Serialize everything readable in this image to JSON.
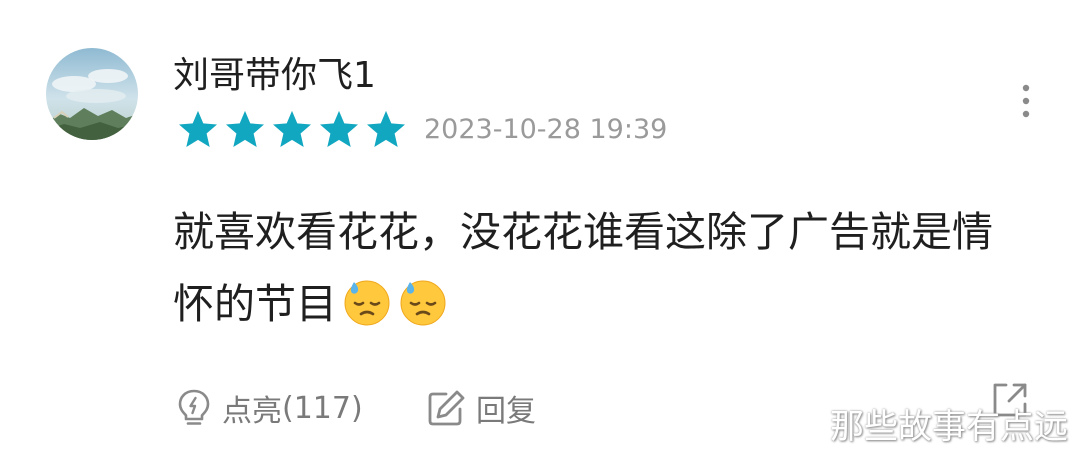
{
  "user": {
    "name": "刘哥带你飞1",
    "avatar_icon": "landscape-avatar"
  },
  "rating": {
    "stars": 5,
    "max_stars": 5,
    "star_color": "#12a7c0"
  },
  "timestamp": "2023-10-28 19:39",
  "comment": {
    "text": "就喜欢看花花，没花花谁看这除了广告就是情怀的节目",
    "emojis": [
      "downcast-sweat-emoji",
      "downcast-sweat-emoji"
    ]
  },
  "actions": {
    "like_icon": "lightbulb-icon",
    "like_label": "点亮",
    "like_count": "(117)",
    "reply_icon": "edit-icon",
    "reply_label": "回复",
    "share_icon": "share-expand-icon",
    "more_icon": "more-vertical-icon"
  },
  "watermark": "那些故事有点远",
  "colors": {
    "primary_text": "#1f1f1f",
    "secondary_text": "#9a9a9a",
    "action_text": "#7a7a7a",
    "star": "#12a7c0"
  }
}
